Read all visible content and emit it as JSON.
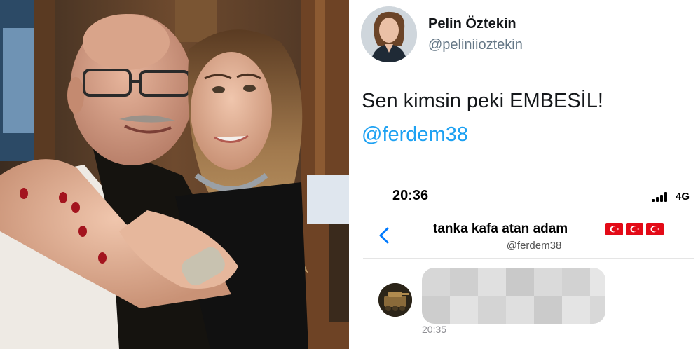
{
  "tweet": {
    "author_name": "Pelin Öztekin",
    "author_handle": "@peliniioztekin",
    "text": "Sen kimsin peki EMBESİL!",
    "mention": "@ferdem38"
  },
  "phone": {
    "status_time": "20:36",
    "network": "4G",
    "chat_title": "tanka kafa atan adam",
    "chat_handle": "@ferdem38",
    "message_time": "20:35",
    "message_blurred": true
  },
  "colors": {
    "link_blue": "#1da1f2",
    "ios_blue": "#007aff",
    "flag_red": "#e30a17",
    "handle_grey": "#657786"
  },
  "icons": {
    "back": "chevron-left-icon",
    "signal": "signal-bars-icon",
    "flag": "turkish-flag-icon"
  }
}
